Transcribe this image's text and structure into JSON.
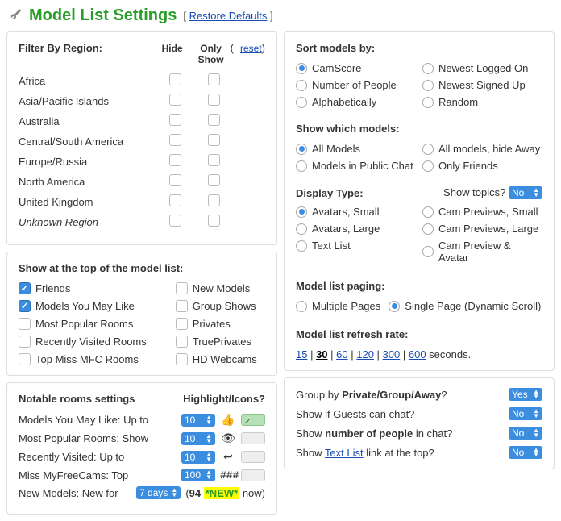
{
  "header": {
    "title": "Model List Settings",
    "restore": "Restore Defaults"
  },
  "region": {
    "title": "Filter By Region:",
    "hide": "Hide",
    "only": "Only Show",
    "reset": "reset",
    "rows": [
      "Africa",
      "Asia/Pacific Islands",
      "Australia",
      "Central/South America",
      "Europe/Russia",
      "North America",
      "United Kingdom",
      "Unknown Region"
    ]
  },
  "topOfList": {
    "title": "Show at the top of the model list:",
    "left": [
      {
        "label": "Friends",
        "checked": true
      },
      {
        "label": "Models You May Like",
        "checked": true
      },
      {
        "label": "Most Popular Rooms",
        "checked": false
      },
      {
        "label": "Recently Visited Rooms",
        "checked": false
      },
      {
        "label": "Top Miss MFC Rooms",
        "checked": false
      }
    ],
    "right": [
      {
        "label": "New Models",
        "checked": false
      },
      {
        "label": "Group Shows",
        "checked": false
      },
      {
        "label": "Privates",
        "checked": false
      },
      {
        "label": "TruePrivates",
        "checked": false
      },
      {
        "label": "HD Webcams",
        "checked": false
      }
    ]
  },
  "notable": {
    "title": "Notable rooms settings",
    "hdr2": "Highlight/Icons?",
    "rows": [
      {
        "label": "Models You May Like: Up to",
        "value": "10",
        "icon": "👍",
        "toggle": true
      },
      {
        "label": "Most Popular Rooms: Show",
        "value": "10",
        "icon": "👁",
        "toggle": false
      },
      {
        "label": "Recently Visited: Up to",
        "value": "10",
        "icon": "↩",
        "toggle": false
      },
      {
        "label": "Miss MyFreeCams: Top",
        "value": "100",
        "hash": "###",
        "toggle": false
      }
    ],
    "newModels": {
      "label": "New Models: New for",
      "value": "7 days",
      "count": "94",
      "badge": "*NEW*",
      "suffix": " now)"
    }
  },
  "sort": {
    "title": "Sort models by:",
    "left": [
      {
        "label": "CamScore",
        "checked": true
      },
      {
        "label": "Number of People",
        "checked": false
      },
      {
        "label": "Alphabetically",
        "checked": false
      }
    ],
    "right": [
      {
        "label": "Newest Logged On",
        "checked": false
      },
      {
        "label": "Newest Signed Up",
        "checked": false
      },
      {
        "label": "Random",
        "checked": false
      }
    ]
  },
  "showWhich": {
    "title": "Show which models:",
    "left": [
      {
        "label": "All Models",
        "checked": true
      },
      {
        "label": "Models in Public Chat",
        "checked": false
      }
    ],
    "right": [
      {
        "label": "All models, hide Away",
        "checked": false
      },
      {
        "label": "Only Friends",
        "checked": false
      }
    ]
  },
  "displayType": {
    "title": "Display Type:",
    "topicsLabel": "Show topics?",
    "topicsValue": "No",
    "left": [
      {
        "label": "Avatars, Small",
        "checked": true
      },
      {
        "label": "Avatars, Large",
        "checked": false
      },
      {
        "label": "Text List",
        "checked": false
      }
    ],
    "right": [
      {
        "label": "Cam Previews, Small",
        "checked": false
      },
      {
        "label": "Cam Previews, Large",
        "checked": false
      },
      {
        "label": "Cam Preview & Avatar",
        "checked": false
      }
    ]
  },
  "paging": {
    "title": "Model list paging:",
    "options": [
      {
        "label": "Multiple Pages",
        "checked": false
      },
      {
        "label": "Single Page (Dynamic Scroll)",
        "checked": true
      }
    ]
  },
  "refresh": {
    "title": "Model list refresh rate:",
    "options": [
      "15",
      "30",
      "60",
      "120",
      "300",
      "600"
    ],
    "current": "30",
    "suffix": "seconds."
  },
  "bottom": {
    "groupBy": {
      "label_pre": "Group by ",
      "label_bold": "Private/Group/Away",
      "label_post": "?",
      "value": "Yes"
    },
    "guests": {
      "label": "Show if Guests can chat?",
      "value": "No"
    },
    "numPeople": {
      "label_pre": "Show ",
      "label_bold": "number of people",
      "label_post": " in chat?",
      "value": "No"
    },
    "textList": {
      "label_pre": "Show ",
      "label_link": "Text List",
      "label_post": " link at the top?",
      "value": "No"
    }
  }
}
